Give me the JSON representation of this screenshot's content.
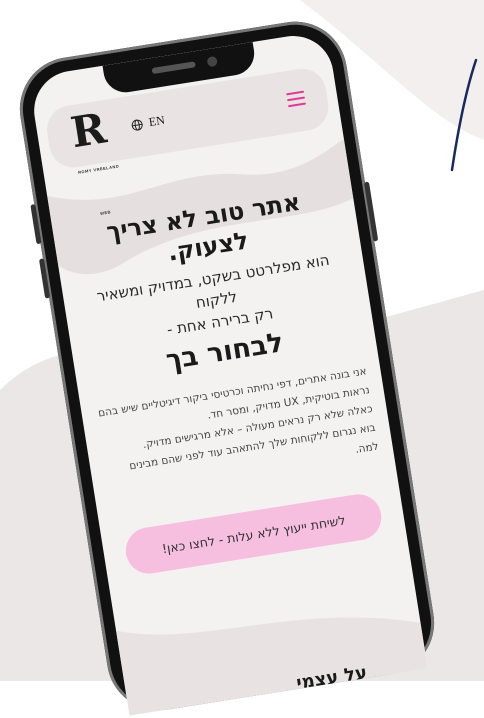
{
  "header": {
    "logo_letter": "R",
    "logo_caption": "ROMY VREELAND WEB",
    "language": "EN"
  },
  "hero": {
    "headline_line1": "אתר טוב לא צריך לצעוק.",
    "sub_line1": "הוא מפלרטט בשקט, במדויק ומשאיר ללקוח",
    "sub_line2": "רק ברירה אחת -",
    "choose": "לבחור בך"
  },
  "body": {
    "p1": "אני בונה אתרים, דפי נחיתה וכרטיסי ביקור דיגיטליים שיש בהם נראות בוטיקית, UX מדויק, ומסר חד.",
    "p2": "כאלה שלא רק נראים מעולה – אלא מרגישים מדויק.",
    "p3": "בוא נגרום ללקוחות שלך להתאהב עוד לפני שהם מבינים למה."
  },
  "cta": {
    "label": "לשיחת ייעוץ ללא עלות - לחצו כאן!"
  },
  "bottom": {
    "partial_heading": "על עצמי"
  },
  "colors": {
    "accent": "#e0399a",
    "cta_bg": "#f6bfe0",
    "screen_bg": "#f4f1f1"
  },
  "icons": {
    "globe": "globe-icon",
    "menu": "hamburger-menu-icon"
  }
}
